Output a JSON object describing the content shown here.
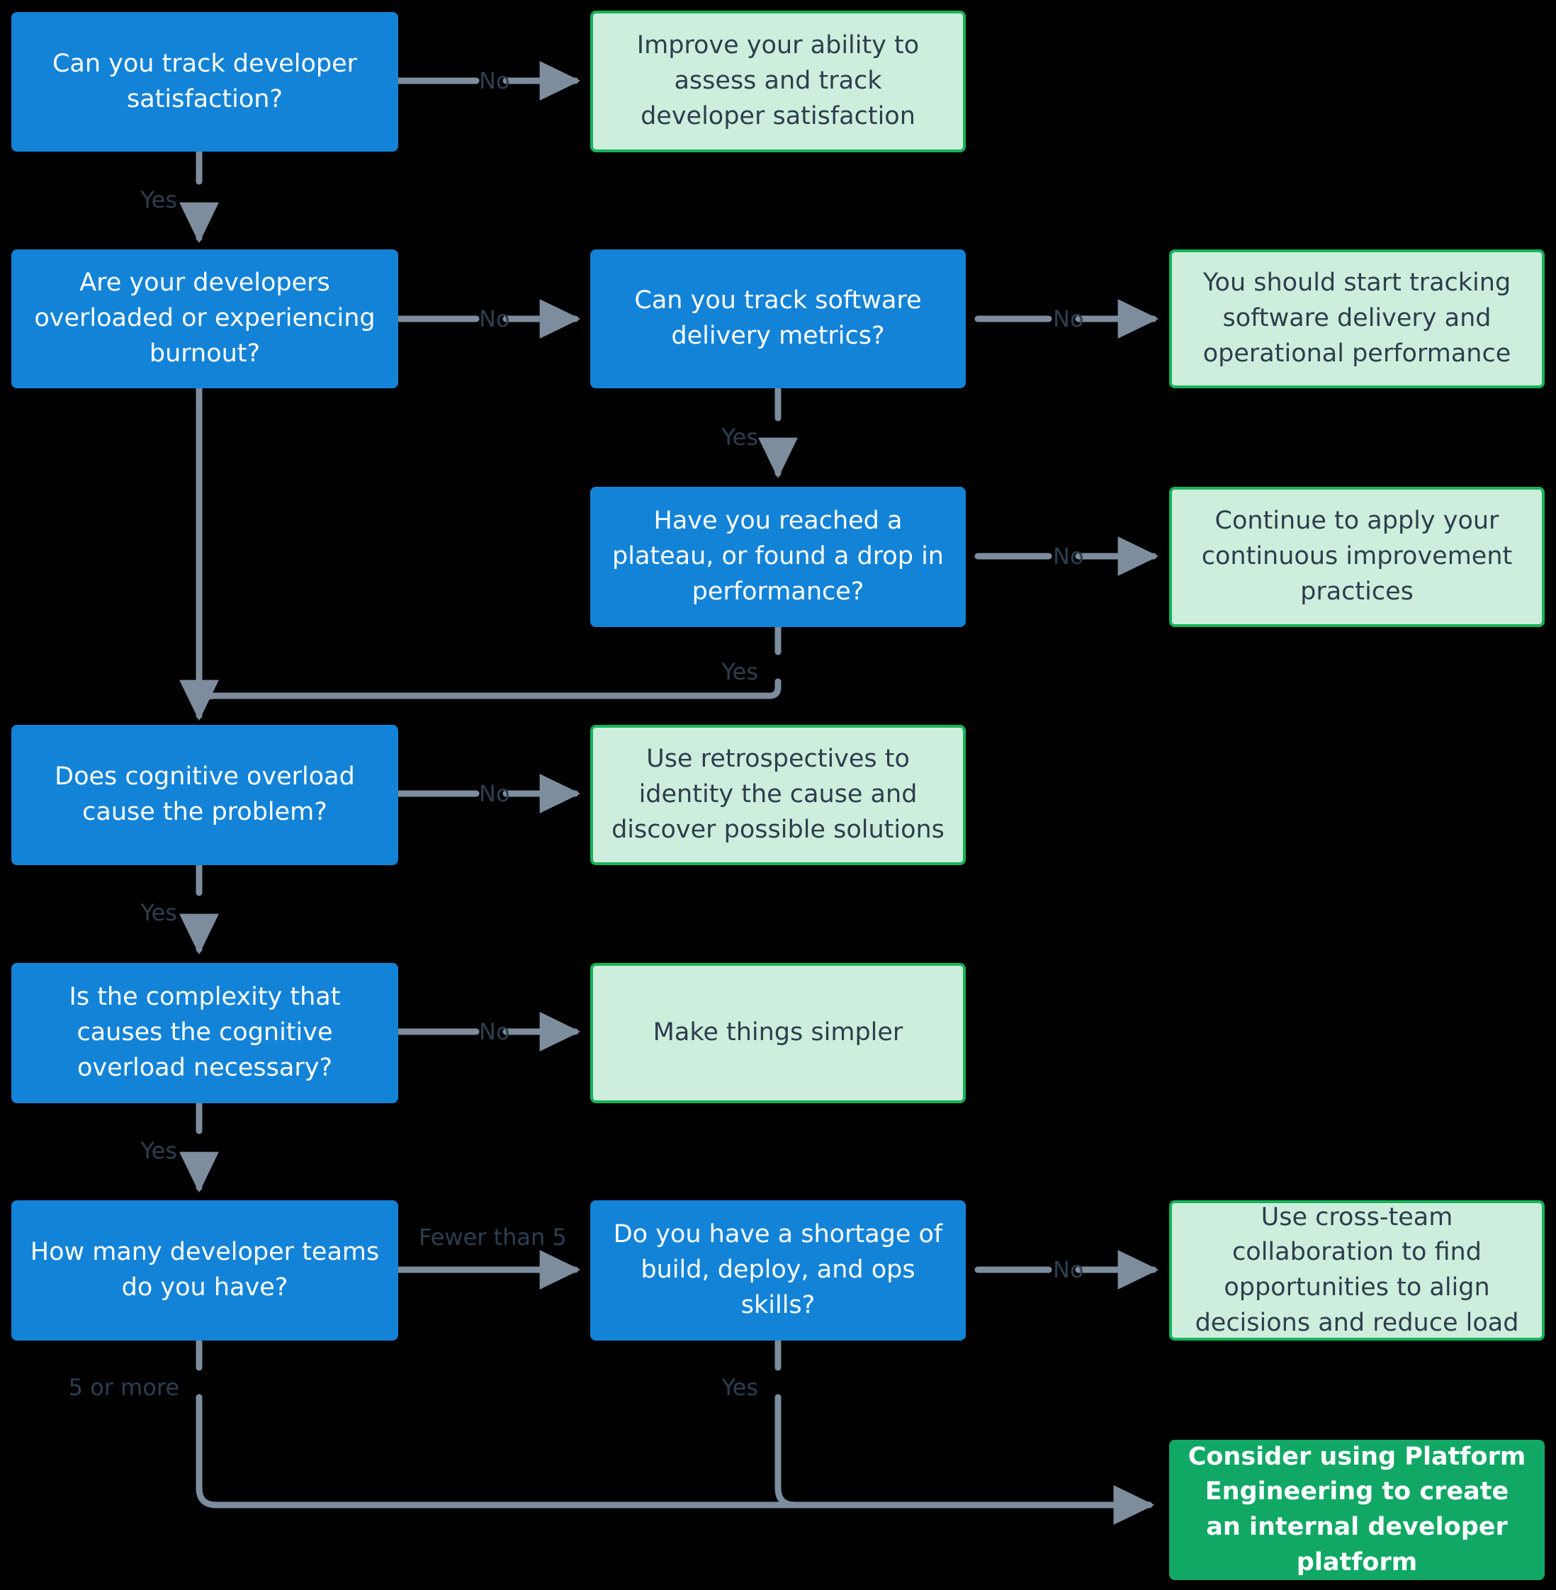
{
  "diagram": {
    "title": "Developer experience and platform engineering decision flowchart",
    "colors": {
      "background": "#000000",
      "decision_fill": "#1383d8",
      "decision_text": "#ffffff",
      "outcome_fill": "#cdeedc",
      "outcome_border": "#15b458",
      "outcome_text": "#2d3e4e",
      "final_fill": "#11a866",
      "final_text": "#ffffff",
      "connector": "#7d8d9e",
      "label_text": "#2d3e4e"
    },
    "nodes": [
      {
        "id": "n1",
        "type": "decision",
        "text": "Can you track developer satisfaction?"
      },
      {
        "id": "n2",
        "type": "outcome",
        "text": "Improve your ability to assess and track developer satisfaction"
      },
      {
        "id": "n3",
        "type": "decision",
        "text": "Are your developers overloaded or experiencing burnout?"
      },
      {
        "id": "n4",
        "type": "decision",
        "text": "Can you track software delivery metrics?"
      },
      {
        "id": "n5",
        "type": "outcome",
        "text": "You should start tracking software delivery and operational performance"
      },
      {
        "id": "n6",
        "type": "decision",
        "text": "Have you reached a plateau, or found a drop in performance?"
      },
      {
        "id": "n7",
        "type": "outcome",
        "text": "Continue to apply your continuous improvement practices"
      },
      {
        "id": "n8",
        "type": "decision",
        "text": "Does cognitive overload cause the problem?"
      },
      {
        "id": "n9",
        "type": "outcome",
        "text": "Use retrospectives to identity the cause and discover possible solutions"
      },
      {
        "id": "n10",
        "type": "decision",
        "text": "Is the complexity that causes the cognitive overload necessary?"
      },
      {
        "id": "n11",
        "type": "outcome",
        "text": "Make things simpler"
      },
      {
        "id": "n12",
        "type": "decision",
        "text": "How many developer teams do you have?"
      },
      {
        "id": "n13",
        "type": "decision",
        "text": "Do you have a shortage of build, deploy, and ops skills?"
      },
      {
        "id": "n14",
        "type": "outcome",
        "text": "Use cross-team collaboration to find opportunities to align decisions and reduce load"
      },
      {
        "id": "n15",
        "type": "final",
        "text": "Consider using Platform Engineering to create an internal developer platform"
      }
    ],
    "edges": [
      {
        "id": "e1",
        "from": "n1",
        "to": "n2",
        "label": "No"
      },
      {
        "id": "e2",
        "from": "n1",
        "to": "n3",
        "label": "Yes"
      },
      {
        "id": "e3",
        "from": "n3",
        "to": "n4",
        "label": "No"
      },
      {
        "id": "e4",
        "from": "n4",
        "to": "n5",
        "label": "No"
      },
      {
        "id": "e5",
        "from": "n4",
        "to": "n6",
        "label": "Yes"
      },
      {
        "id": "e6",
        "from": "n6",
        "to": "n7",
        "label": "No"
      },
      {
        "id": "e7",
        "from": "n6",
        "to": "n8",
        "label": "Yes"
      },
      {
        "id": "e8",
        "from": "n3",
        "to": "n8",
        "label": "Yes"
      },
      {
        "id": "e9",
        "from": "n8",
        "to": "n9",
        "label": "No"
      },
      {
        "id": "e10",
        "from": "n8",
        "to": "n10",
        "label": "Yes"
      },
      {
        "id": "e11",
        "from": "n10",
        "to": "n11",
        "label": "No"
      },
      {
        "id": "e12",
        "from": "n10",
        "to": "n12",
        "label": "Yes"
      },
      {
        "id": "e13",
        "from": "n12",
        "to": "n13",
        "label": "Fewer than 5"
      },
      {
        "id": "e14",
        "from": "n13",
        "to": "n14",
        "label": "No"
      },
      {
        "id": "e15",
        "from": "n13",
        "to": "n15",
        "label": "Yes"
      },
      {
        "id": "e16",
        "from": "n12",
        "to": "n15",
        "label": "5 or more"
      }
    ],
    "labels": {
      "l_no_1": "No",
      "l_yes_1": "Yes",
      "l_no_2": "No",
      "l_no_3": "No",
      "l_yes_2": "Yes",
      "l_no_4": "No",
      "l_yes_3": "Yes",
      "l_yes_4": "Yes",
      "l_no_5": "No",
      "l_yes_5": "Yes",
      "l_no_6": "No",
      "l_yes_6": "Yes",
      "l_fewer_than_5": "Fewer than 5",
      "l_no_7": "No",
      "l_yes_7": "Yes",
      "l_5_or_more": "5 or more"
    }
  }
}
